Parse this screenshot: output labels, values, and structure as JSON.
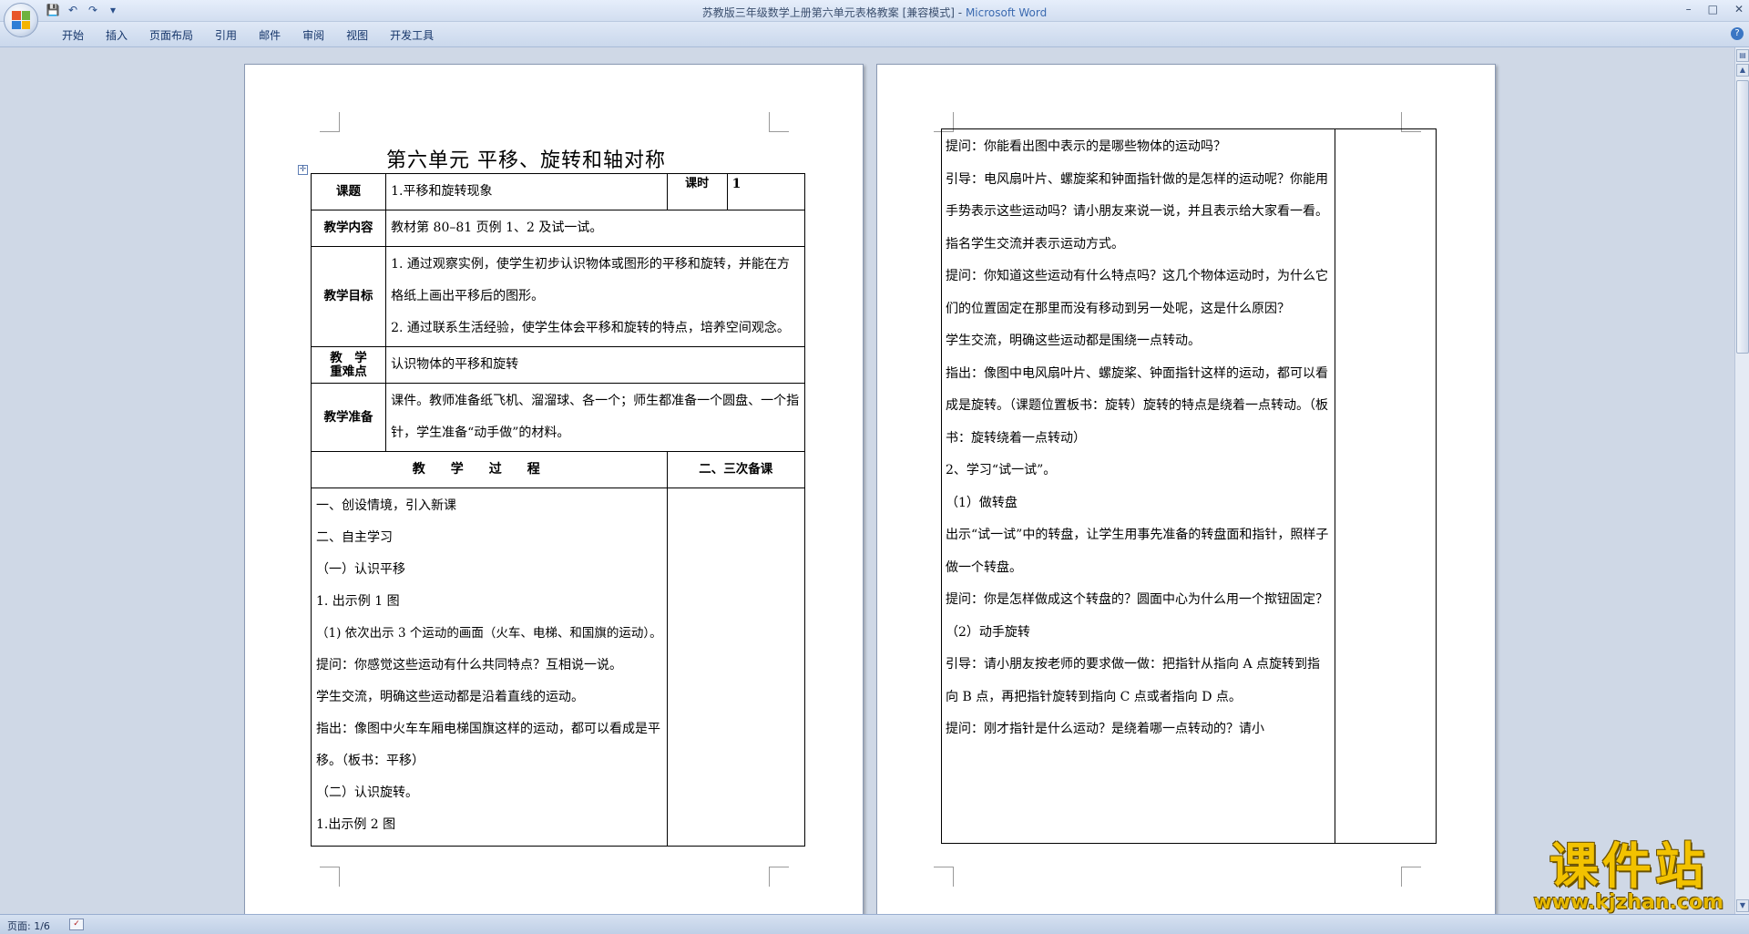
{
  "window": {
    "title": "苏教版三年级数学上册第六单元表格教案 [兼容模式]",
    "app_name": "Microsoft Word",
    "controls": [
      "–",
      "□",
      "✕"
    ]
  },
  "qat": {
    "save": "💾",
    "undo": "↶",
    "redo": "↷",
    "more": "▾"
  },
  "ribbon": {
    "tabs": [
      "开始",
      "插入",
      "页面布局",
      "引用",
      "邮件",
      "审阅",
      "视图",
      "开发工具"
    ]
  },
  "doc": {
    "title": "第六单元 平移、旋转和轴对称",
    "table": {
      "course_label": "课题",
      "course_value": "1.平移和旋转现象",
      "period_label": "课时",
      "period_value": "1",
      "content_label": "教学内容",
      "content_value": "教材第 80–81 页例 1、2 及试一试。",
      "goals_label": "教学目标",
      "goals": [
        "1. 通过观察实例，使学生初步认识物体或图形的平移和旋转，并能在方格纸上画出平移后的图形。",
        "2. 通过联系生活经验，使学生体会平移和旋转的特点，培养空间观念。"
      ],
      "focus_label_1": "教　学",
      "focus_label_2": "重难点",
      "focus_value": "认识物体的平移和旋转",
      "prep_label": "教学准备",
      "prep_value": "课件。教师准备纸飞机、溜溜球、各一个；师生都准备一个圆盘、一个指针，学生准备“动手做”的材料。",
      "process_header": "教学过程",
      "notes_header": "二、三次备课",
      "process_lines": [
        "一、创设情境，引入新课",
        "二、自主学习",
        "（一）认识平移",
        "1.  出示例 1 图",
        "（1) 依次出示 3 个运动的画面（火车、电梯、和国旗的运动）。",
        "提问：你感觉这些运动有什么共同特点？互相说一说。",
        "学生交流，明确这些运动都是沿着直线的运动。",
        "指出：像图中火车车厢电梯国旗这样的运动，都可以看成是平移。（板书：平移）",
        "（二）认识旋转。",
        "1.出示例 2 图"
      ]
    },
    "page2_lines": [
      "提问：你能看出图中表示的是哪些物体的运动吗？",
      "引导：电风扇叶片、螺旋桨和钟面指针做的是怎样的运动呢？你能用手势表示这些运动吗？请小朋友来说一说，并且表示给大家看一看。",
      "指名学生交流并表示运动方式。",
      "提问：你知道这些运动有什么特点吗？这几个物体运动时，为什么它们的位置固定在那里而没有移动到另一处呢，这是什么原因？",
      "学生交流，明确这些运动都是围绕一点转动。",
      "指出：像图中电风扇叶片、螺旋桨、钟面指针这样的运动，都可以看成是旋转。（课题位置板书：旋转）旋转的特点是绕着一点转动。（板书：旋转绕着一点转动）",
      "2、学习“试一试”。",
      "（1）做转盘",
      "出示“试一试”中的转盘，让学生用事先准备的转盘面和指针，照样子做一个转盘。",
      "提问：你是怎样做成这个转盘的？圆面中心为什么用一个揿钮固定？",
      "（2）动手旋转",
      "引导：请小朋友按老师的要求做一做：把指针从指向 A 点旋转到指向 B 点，再把指针旋转到指向 C 点或者指向 D 点。",
      "提问：刚才指针是什么运动？是绕着哪一点转动的？请小"
    ]
  },
  "status": {
    "page": "页面: 1/6"
  },
  "watermark": {
    "name": "课件站",
    "url": "www.kjzhan.com"
  },
  "colors": {
    "accent": "#3b6ab0",
    "ribbon": "#d2def0",
    "workspace": "#cfd8e6",
    "watermark": "#f2c200"
  }
}
